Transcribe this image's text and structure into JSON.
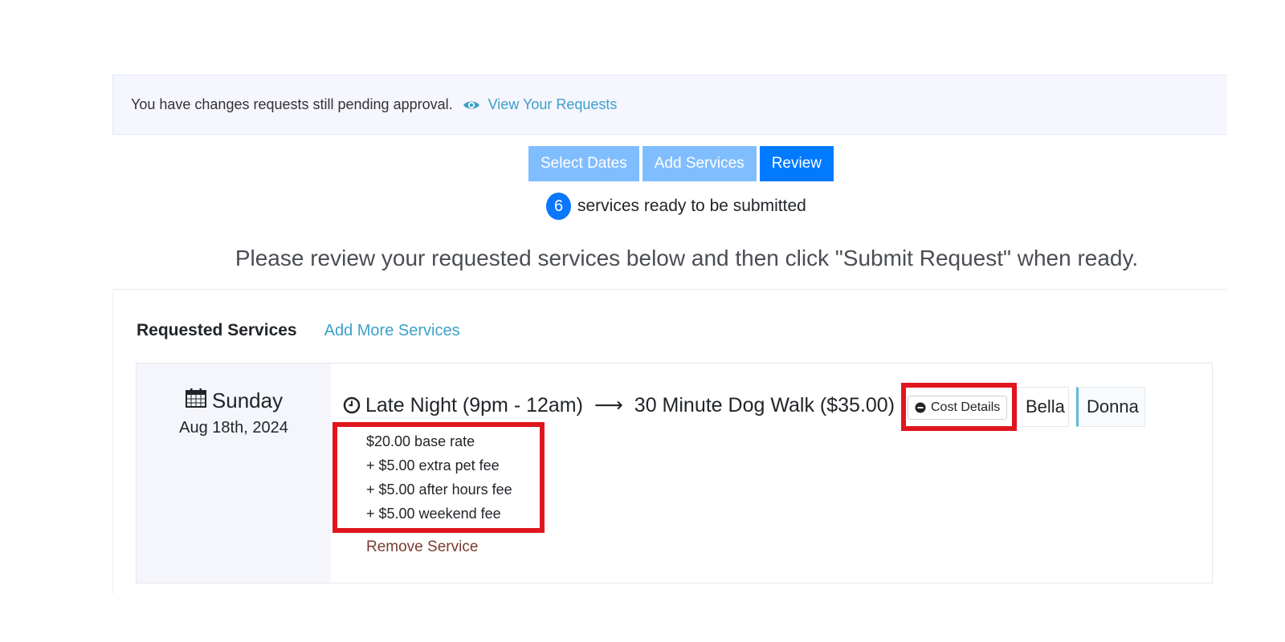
{
  "alert": {
    "message": "You have changes requests still pending approval.",
    "link_label": "View Your Requests",
    "link_icon": "eye-icon"
  },
  "steps": [
    {
      "label": "Select Dates",
      "state": "done"
    },
    {
      "label": "Add Services",
      "state": "done"
    },
    {
      "label": "Review",
      "state": "active"
    }
  ],
  "ready": {
    "count": "6",
    "text": "services ready to be submitted"
  },
  "instructions": "Please review your requested services below and then click \"Submit Request\" when ready.",
  "requested": {
    "title": "Requested Services",
    "add_more_label": "Add More Services"
  },
  "service": {
    "day": "Sunday",
    "date": "Aug 18th, 2024",
    "time": "Late Night (9pm - 12am)",
    "arrow": "⟶",
    "name": "30 Minute Dog Walk ($35.00)",
    "cost_details_label": "Cost Details",
    "pets": [
      "Bella",
      "Donna"
    ],
    "breakdown": [
      "$20.00 base rate",
      "+ $5.00 extra pet fee",
      "+ $5.00 after hours fee",
      "+ $5.00 weekend fee"
    ],
    "remove_label": "Remove Service"
  },
  "colors": {
    "primary": "#007bff",
    "step_done": "#80bdfe",
    "link": "#3ca0c8",
    "highlight": "#e0161f",
    "remove": "#7a3b2e"
  }
}
